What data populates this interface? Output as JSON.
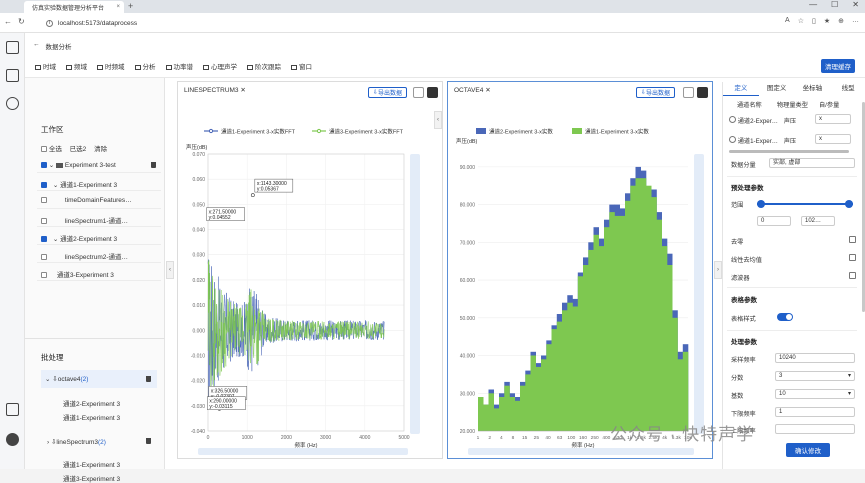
{
  "browser": {
    "tab_title": "仿真实验数据管理分析平台",
    "url": "localhost:5173/dataprocess"
  },
  "breadcrumb": {
    "back": "←",
    "title": "数据分析"
  },
  "toolbar": {
    "items": [
      "时域",
      "频域",
      "时频域",
      "分析",
      "功率谱",
      "心理声学",
      "阶次跟踪",
      "窗口"
    ],
    "clear_cache": "清理缓存"
  },
  "workspace": {
    "title": "工作区",
    "select_all": "全选",
    "selected": "已选",
    "selected_count": "2",
    "clear": "清除",
    "tree": [
      {
        "label": "Experiment 3-test",
        "checked": true
      },
      {
        "label": "通道1-Experiment 3",
        "checked": true
      },
      {
        "label": "timeDomainFeatures…",
        "checked": false
      },
      {
        "label": "lineSpectrum1-通道…",
        "checked": false
      },
      {
        "label": "通道2-Experiment 3",
        "checked": true
      },
      {
        "label": "lineSpectrum2-通道…",
        "checked": false
      },
      {
        "label": "通道3-Experiment 3",
        "checked": false
      }
    ]
  },
  "batch": {
    "title": "批处理",
    "groups": [
      {
        "name": "octave4",
        "count": "(2)",
        "items": [
          "通道2-Experiment 3",
          "通道1-Experiment 3"
        ]
      },
      {
        "name": "lineSpectrum3",
        "count": "(2)",
        "items": [
          "通道1-Experiment 3",
          "通道3-Experiment 3"
        ]
      }
    ]
  },
  "panel1": {
    "tab": "LINESPECTRUM3",
    "export": "导出数据",
    "ylabel": "声压(dB)",
    "xlabel": "频率 (Hz)"
  },
  "panel2": {
    "tab": "OCTAVE4",
    "export": "导出数据",
    "ylabel": "声压(dB)",
    "xlabel": "频率 (Hz)"
  },
  "chart_data": [
    {
      "type": "line",
      "title": "LINESPECTRUM3",
      "xlabel": "频率 (Hz)",
      "ylabel": "声压(dB)",
      "xlim": [
        0,
        5000
      ],
      "ylim": [
        -0.04,
        0.07
      ],
      "x_ticks": [
        0,
        1000,
        2000,
        3000,
        4000,
        5000
      ],
      "y_ticks": [
        -0.04,
        -0.03,
        -0.02,
        -0.01,
        0,
        0.01,
        0.02,
        0.03,
        0.04,
        0.05,
        0.06,
        0.07
      ],
      "y_tick_labels": [
        "-0.040",
        "-0.030",
        "-0.020",
        "-0.010",
        "0.000",
        "0.010",
        "0.020",
        "0.030",
        "0.040",
        "0.050",
        "0.060",
        "0.070"
      ],
      "legend": "top",
      "series": [
        {
          "name": "通道1-Experiment 3-x实数FFT",
          "color": "#4a67b8"
        },
        {
          "name": "通道3-Experiment 3-x实数FFT",
          "color": "#7ec850"
        }
      ],
      "annotations": [
        {
          "x": 1143.3,
          "y": 0.05367,
          "text": [
            "x:1143.30000",
            "y:0.05367"
          ]
        },
        {
          "x": 271.5,
          "y": 0.04552,
          "text": [
            "x:271.50000",
            "y:0.04552"
          ]
        },
        {
          "x": 326.5,
          "y": -0.02307,
          "text": [
            "x:326.50000",
            "y:-0.02307"
          ]
        },
        {
          "x": 290.0,
          "y": -0.03115,
          "text": [
            "x:290.00000",
            "y:-0.03115"
          ]
        }
      ]
    },
    {
      "type": "bar",
      "title": "OCTAVE4",
      "xlabel": "频率 (Hz)",
      "ylabel": "声压(dB)",
      "ylim": [
        20000,
        95000
      ],
      "y_ticks": [
        20000,
        30000,
        40000,
        50000,
        60000,
        70000,
        80000,
        90000
      ],
      "y_tick_labels": [
        "20.000",
        "30.000",
        "40.000",
        "50.000",
        "60.000",
        "70.000",
        "80.000",
        "90.000"
      ],
      "categories": [
        "1",
        "1.25",
        "1.6",
        "2",
        "2.5",
        "3.15",
        "4",
        "5",
        "6.3",
        "8",
        "10",
        "12.5",
        "16",
        "20",
        "25",
        "31.5",
        "40",
        "50",
        "63",
        "80",
        "100",
        "125",
        "160",
        "200",
        "250",
        "315",
        "400",
        "500",
        "630",
        "800",
        "1k",
        "1.25k",
        "1.6k",
        "2k",
        "2.5k",
        "3.15k",
        "4k",
        "5k",
        "6.3k",
        "8k"
      ],
      "x_tick_labels": [
        "1",
        "2",
        "4",
        "8",
        "15",
        "25",
        "40",
        "63",
        "100",
        "160",
        "250",
        "400",
        "630",
        "1k",
        "1.6k",
        "2.5k",
        "4k",
        "6.3k",
        "10k"
      ],
      "legend": "top",
      "series": [
        {
          "name": "通道2-Experiment 3-x实数",
          "color": "#4a67b8",
          "values": [
            29000,
            27000,
            31000,
            27000,
            30000,
            33000,
            30000,
            29000,
            33000,
            36000,
            41000,
            38000,
            40000,
            44000,
            48000,
            51000,
            54000,
            56000,
            55000,
            62000,
            66000,
            70000,
            74000,
            71000,
            76000,
            80000,
            80000,
            79000,
            83000,
            87000,
            90000,
            89000,
            83000,
            84000,
            78000,
            71000,
            67000,
            52000,
            41000,
            43000
          ]
        },
        {
          "name": "通道1-Experiment 3-x实数",
          "color": "#7ec850",
          "values": [
            29000,
            27000,
            30000,
            26000,
            29000,
            32000,
            29000,
            28000,
            32000,
            35000,
            40000,
            37000,
            39000,
            43000,
            47000,
            49000,
            52000,
            54000,
            53000,
            61000,
            64000,
            68000,
            72000,
            69000,
            74000,
            78000,
            77000,
            77000,
            81000,
            85000,
            87000,
            87000,
            85000,
            82000,
            76000,
            69000,
            64000,
            50000,
            39000,
            41000
          ]
        }
      ]
    }
  ],
  "rightpanel": {
    "tabs": [
      "定义",
      "图定义",
      "坐标轴",
      "线型"
    ],
    "table_headers": [
      "通道名称",
      "物理量类型",
      "自/参量"
    ],
    "channels": [
      {
        "name": "通道2-Exper…",
        "type": "声压",
        "axis": "x"
      },
      {
        "name": "通道1-Exper…",
        "type": "声压",
        "axis": "x"
      }
    ],
    "data_component_label": "数据分量",
    "data_component_value": "实部, 虚部",
    "preprocess_title": "预处理参数",
    "range_label": "范围",
    "range_min": "0",
    "range_max": "102…",
    "range_fraction": [
      0.0,
      1.0
    ],
    "zero_label": "去零",
    "detrend_label": "线性去均值",
    "filter_label": "滤波器",
    "table_params_title": "表格参数",
    "table_style_label": "表格样式",
    "table_style_on": true,
    "process_title": "处理参数",
    "params": [
      {
        "label": "采样频率",
        "value": "10240"
      },
      {
        "label": "分数",
        "value": "3"
      },
      {
        "label": "基数",
        "value": "10"
      },
      {
        "label": "下限频率",
        "value": "1"
      },
      {
        "label": "上限频率",
        "value": ""
      }
    ],
    "confirm": "确认修改"
  },
  "watermark": "公众号 · 快特声学",
  "colors": {
    "accent": "#1f5fc9",
    "series_blue": "#4a67b8",
    "series_green": "#7ec850"
  }
}
